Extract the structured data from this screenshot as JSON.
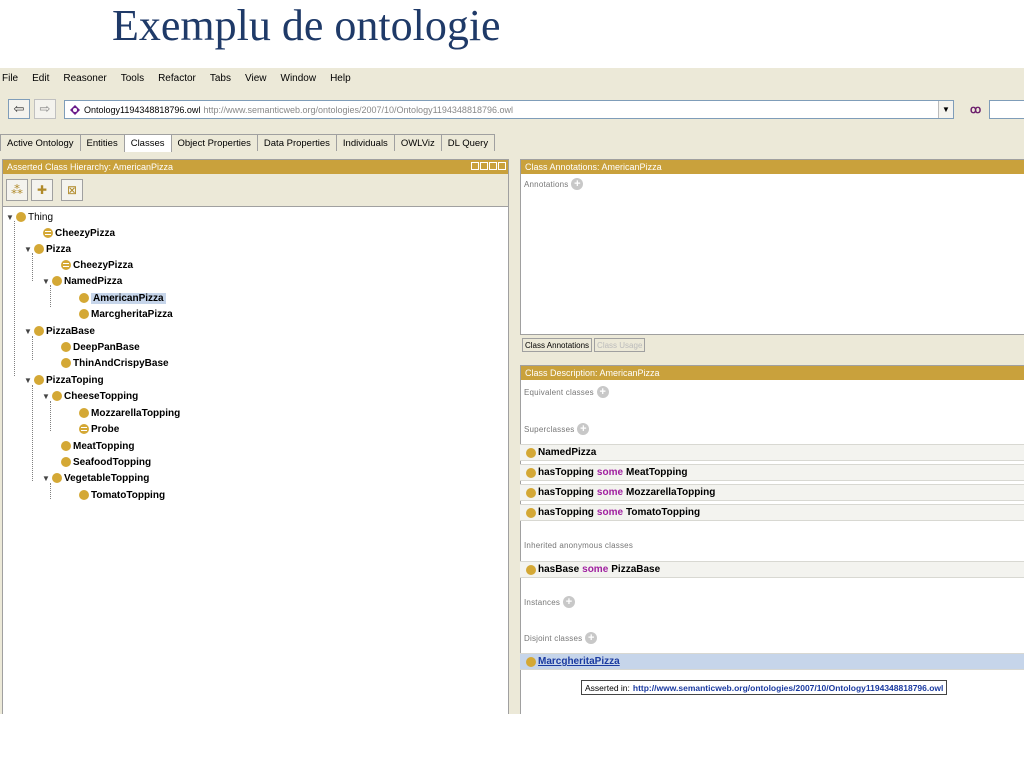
{
  "slide": {
    "title": "Exemplu de ontologie"
  },
  "menu": [
    "File",
    "Edit",
    "Reasoner",
    "Tools",
    "Refactor",
    "Tabs",
    "View",
    "Window",
    "Help"
  ],
  "address": {
    "name": "Ontology1194348818796.owl",
    "uri": "http://www.semanticweb.org/ontologies/2007/10/Ontology1194348818796.owl"
  },
  "tabs": [
    "Active Ontology",
    "Entities",
    "Classes",
    "Object Properties",
    "Data Properties",
    "Individuals",
    "OWLViz",
    "DL Query"
  ],
  "active_tab": "Classes",
  "hierarchy": {
    "header": "Asserted Class Hierarchy: AmericanPizza",
    "nodes": [
      "Thing",
      "CheezyPizza",
      "Pizza",
      "CheezyPizza",
      "NamedPizza",
      "AmericanPizza",
      "MarcgheritaPizza",
      "PizzaBase",
      "DeepPanBase",
      "ThinAndCrispyBase",
      "PizzaToping",
      "CheeseTopping",
      "MozzarellaTopping",
      "Probe",
      "MeatTopping",
      "SeafoodTopping",
      "VegetableTopping",
      "TomatoTopping"
    ]
  },
  "annotations": {
    "header": "Class Annotations: AmericanPizza",
    "label": "Annotations",
    "subtab_active": "Class Annotations",
    "subtab_other": "Class Usage"
  },
  "description": {
    "header": "Class Description: AmericanPizza",
    "equivalent_label": "Equivalent classes",
    "superclasses_label": "Superclasses",
    "inherited_label": "Inherited anonymous classes",
    "instances_label": "Instances",
    "disjoint_label": "Disjoint classes",
    "keyword": "some",
    "superclasses": [
      {
        "left": "NamedPizza",
        "right": ""
      },
      {
        "left": "hasTopping",
        "right": "MeatTopping"
      },
      {
        "left": "hasTopping",
        "right": "MozzarellaTopping"
      },
      {
        "left": "hasTopping",
        "right": "TomatoTopping"
      }
    ],
    "inherited": {
      "left": "hasBase",
      "right": "PizzaBase"
    },
    "disjoint": "MarcgheritaPizza"
  },
  "tooltip": {
    "label": "Asserted in:",
    "uri": "http://www.semanticweb.org/ontologies/2007/10/Ontology1194348818796.owl"
  }
}
